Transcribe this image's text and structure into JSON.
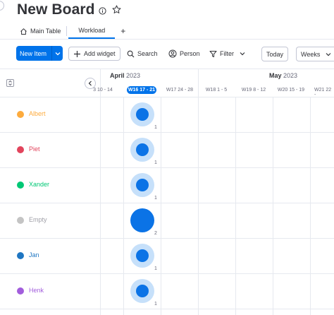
{
  "board": {
    "title": "New Board"
  },
  "tabs": [
    {
      "label": "Main Table",
      "active": false
    },
    {
      "label": "Workload",
      "active": true
    }
  ],
  "tabs_add": "+",
  "toolbar": {
    "new_item": "New Item",
    "add_widget": "Add widget",
    "search": "Search",
    "person": "Person",
    "filter": "Filter",
    "today": "Today",
    "view_select": "Weeks"
  },
  "timeline": {
    "months": [
      {
        "name": "April",
        "year": "2023"
      },
      {
        "name": "May",
        "year": "2023"
      }
    ],
    "weeks": [
      "3 10 - 14",
      "W16 17 - 21",
      "W17 24 - 28",
      "W18 1 - 5",
      "W19 8 - 12",
      "W20 15 - 19",
      "W21 22 -"
    ],
    "current_week_index": 1
  },
  "colors": {
    "accent": "#0073ea",
    "bubble_light": "#c6e0fa",
    "bubble_dark": "#0b73e6"
  },
  "people": [
    {
      "name": "Albert",
      "color": "#fdab3d",
      "count": "1",
      "load": "partial"
    },
    {
      "name": "Piet",
      "color": "#e2445c",
      "count": "1",
      "load": "partial"
    },
    {
      "name": "Xander",
      "color": "#00c875",
      "count": "1",
      "load": "partial"
    },
    {
      "name": "Empty",
      "color": "#c4c4c4",
      "count": "2",
      "load": "full"
    },
    {
      "name": "Jan",
      "color": "#1f76c2",
      "count": "1",
      "load": "partial"
    },
    {
      "name": "Henk",
      "color": "#a25ddc",
      "count": "1",
      "load": "partial"
    }
  ]
}
